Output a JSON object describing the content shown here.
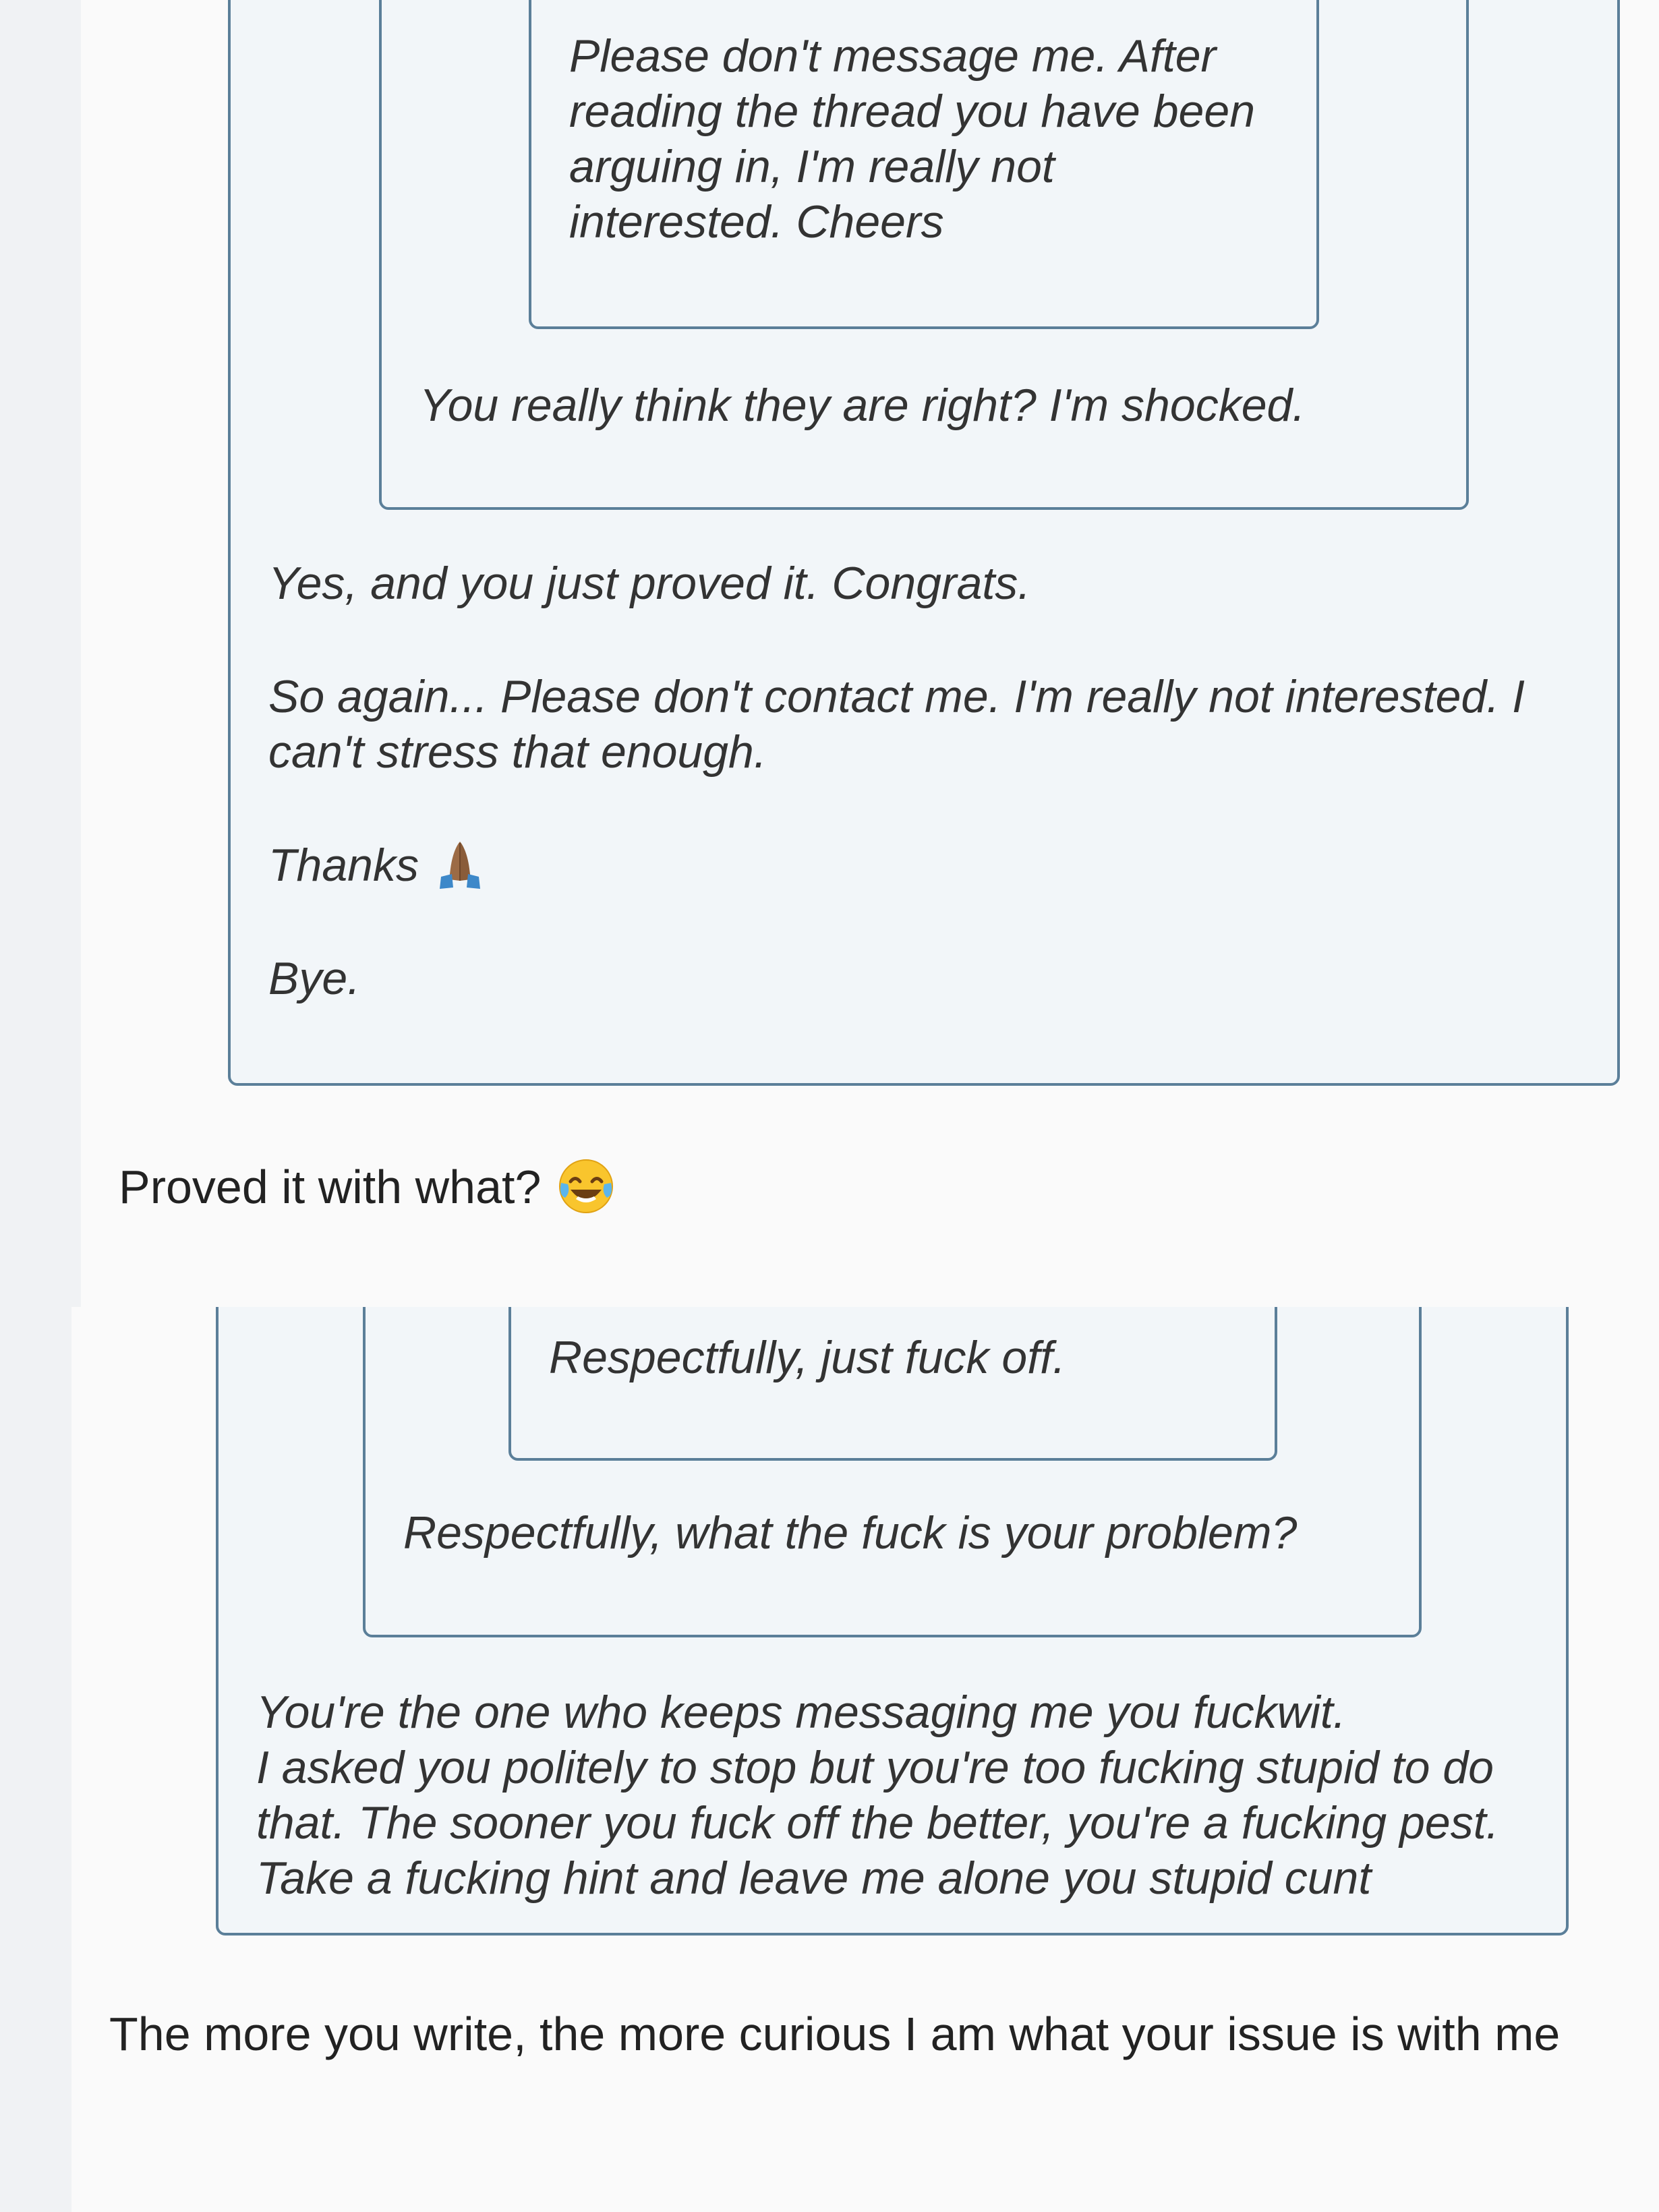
{
  "screenshot_top": {
    "inner_quote": {
      "lines": [
        "Please don't message me. After",
        "reading the thread you have been",
        "arguing in, I'm really not",
        "interested. Cheers"
      ]
    },
    "middle_quote": {
      "text": "You really think they are right? I'm shocked."
    },
    "outer_quote": {
      "para1": "Yes, and you just proved it. Congrats.",
      "para2_lines": [
        "So again... Please don't contact me. I'm really not interested. I",
        "can't stress that enough."
      ],
      "para3": "Thanks",
      "para3_emoji": "folded-hands-icon",
      "para4": "Bye."
    },
    "reply": {
      "text": "Proved it with what?",
      "emoji": "face-with-tears-of-joy-icon"
    }
  },
  "screenshot_bottom": {
    "inner_quote": {
      "text": "Respectfully, just fuck off."
    },
    "middle_quote": {
      "text": "Respectfully, what the fuck is your problem?"
    },
    "outer_quote": {
      "lines": [
        "You're the one who keeps messaging me you fuckwit.",
        "I asked you politely to stop but you're too fucking stupid to do",
        "that. The sooner you fuck off the better, you're a fucking pest.",
        "Take a fucking hint and leave me alone you stupid cunt"
      ]
    },
    "reply": {
      "text": "The more you write, the more curious I am what your issue is with me"
    }
  },
  "colors": {
    "page_gutter": "#f0f2f4",
    "panel_background": "#fafafa",
    "quote_background": "#f2f6f9",
    "quote_border": "#5b7f99",
    "quote_text": "#333333",
    "reply_text": "#222222"
  }
}
